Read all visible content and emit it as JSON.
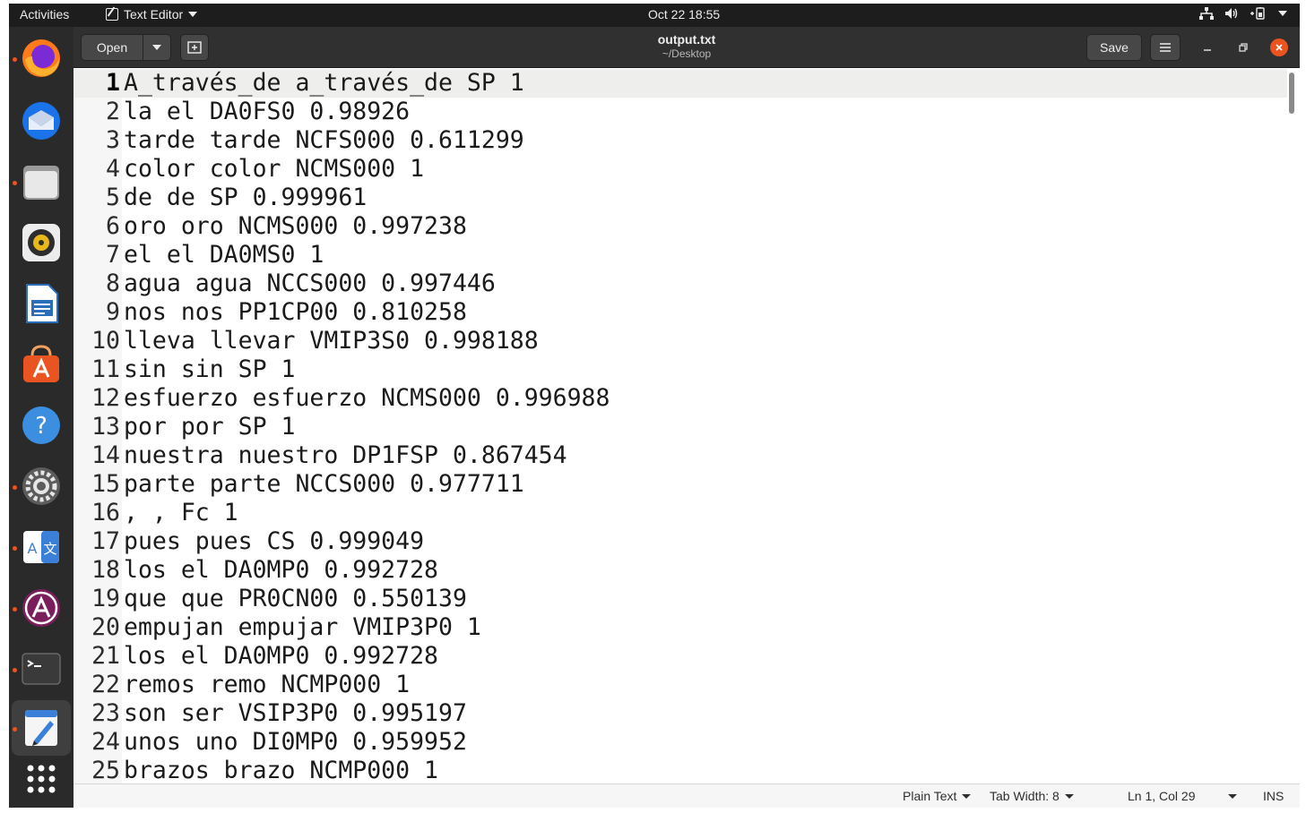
{
  "topbar": {
    "activities": "Activities",
    "app_name": "Text Editor",
    "clock": "Oct 22  18:55",
    "tray_icons": [
      "network-icon",
      "volume-icon",
      "battery-icon",
      "system-menu-icon"
    ]
  },
  "dock": {
    "apps": [
      {
        "name": "firefox-icon",
        "running": true
      },
      {
        "name": "thunderbird-icon",
        "running": false
      },
      {
        "name": "files-icon",
        "running": true
      },
      {
        "name": "rhythmbox-icon",
        "running": false
      },
      {
        "name": "libreoffice-writer-icon",
        "running": false
      },
      {
        "name": "software-center-icon",
        "running": false
      },
      {
        "name": "help-icon",
        "running": false
      },
      {
        "name": "settings-icon",
        "running": true
      },
      {
        "name": "translate-icon",
        "running": true
      },
      {
        "name": "app-store-icon",
        "running": true
      },
      {
        "name": "terminal-icon",
        "running": true
      },
      {
        "name": "text-editor-icon",
        "running": true
      },
      {
        "name": "show-apps-icon",
        "running": false
      }
    ]
  },
  "header": {
    "open_label": "Open",
    "title": "output.txt",
    "subtitle": "~/Desktop",
    "save_label": "Save"
  },
  "editor": {
    "current_line": 1,
    "lines": [
      {
        "n": "1",
        "text": "A_través_de a_través_de SP 1"
      },
      {
        "n": "2",
        "text": "la el DA0FS0 0.98926"
      },
      {
        "n": "3",
        "text": "tarde tarde NCFS000 0.611299"
      },
      {
        "n": "4",
        "text": "color color NCMS000 1"
      },
      {
        "n": "5",
        "text": "de de SP 0.999961"
      },
      {
        "n": "6",
        "text": "oro oro NCMS000 0.997238"
      },
      {
        "n": "7",
        "text": "el el DA0MS0 1"
      },
      {
        "n": "8",
        "text": "agua agua NCCS000 0.997446"
      },
      {
        "n": "9",
        "text": "nos nos PP1CP00 0.810258"
      },
      {
        "n": "10",
        "text": "lleva llevar VMIP3S0 0.998188"
      },
      {
        "n": "11",
        "text": "sin sin SP 1"
      },
      {
        "n": "12",
        "text": "esfuerzo esfuerzo NCMS000 0.996988"
      },
      {
        "n": "13",
        "text": "por por SP 1"
      },
      {
        "n": "14",
        "text": "nuestra nuestro DP1FSP 0.867454"
      },
      {
        "n": "15",
        "text": "parte parte NCCS000 0.977711"
      },
      {
        "n": "16",
        "text": ", , Fc 1"
      },
      {
        "n": "17",
        "text": "pues pues CS 0.999049"
      },
      {
        "n": "18",
        "text": "los el DA0MP0 0.992728"
      },
      {
        "n": "19",
        "text": "que que PR0CN00 0.550139"
      },
      {
        "n": "20",
        "text": "empujan empujar VMIP3P0 1"
      },
      {
        "n": "21",
        "text": "los el DA0MP0 0.992728"
      },
      {
        "n": "22",
        "text": "remos remo NCMP000 1"
      },
      {
        "n": "23",
        "text": "son ser VSIP3P0 0.995197"
      },
      {
        "n": "24",
        "text": "unos uno DI0MP0 0.959952"
      },
      {
        "n": "25",
        "text": "brazos brazo NCMP000 1"
      }
    ]
  },
  "statusbar": {
    "language": "Plain Text",
    "tab_width": "Tab Width: 8",
    "position": "Ln 1, Col 29",
    "mode": "INS"
  },
  "colors": {
    "accent": "#e95420",
    "topbar": "#1d1d1d",
    "dock": "#2a2a2a",
    "headerbar": "#303030",
    "close": "#e95420"
  }
}
